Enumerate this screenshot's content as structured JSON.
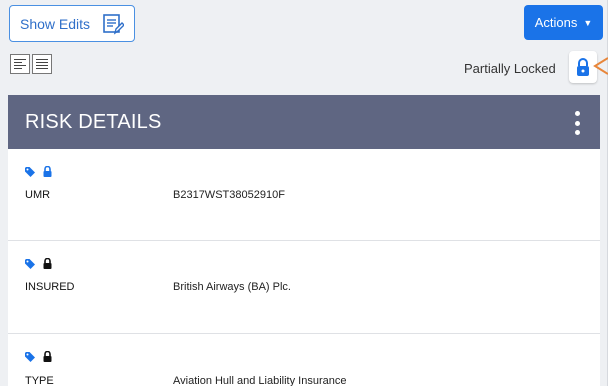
{
  "toolbar": {
    "show_edits_label": "Show Edits",
    "actions_label": "Actions",
    "lock_status": "Partially Locked"
  },
  "panel": {
    "title": "RISK DETAILS",
    "rows": [
      {
        "key": "UMR",
        "value": "B2317WST38052910F",
        "lock_color": "#1a73e8"
      },
      {
        "key": "INSURED",
        "value": "British Airways (BA) Plc.",
        "lock_color": "#111111"
      },
      {
        "key": "TYPE",
        "value": "Aviation Hull and Liability Insurance",
        "lock_color": "#111111"
      }
    ]
  },
  "colors": {
    "accent": "#1a73e8",
    "header": "#5f6682",
    "tag_icon": "#1a73e8",
    "indicator": "#e8863a"
  }
}
